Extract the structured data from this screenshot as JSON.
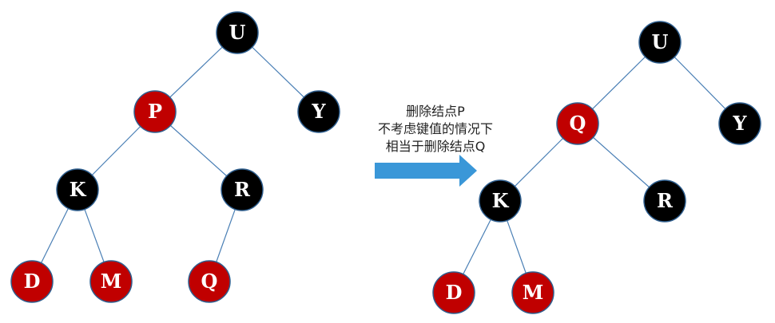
{
  "colors": {
    "black_node": "#000000",
    "red_node": "#c00000",
    "edge": "#4a7fb5",
    "arrow": "#3a97d8"
  },
  "caption": {
    "line1": "删除结点P",
    "line2": "不考虑键值的情况下",
    "line3": "相当于删除结点Q"
  },
  "trees": [
    {
      "id": "before",
      "nodes": [
        {
          "key": "U",
          "color": "black"
        },
        {
          "key": "P",
          "color": "red"
        },
        {
          "key": "Y",
          "color": "black"
        },
        {
          "key": "K",
          "color": "black"
        },
        {
          "key": "R",
          "color": "black"
        },
        {
          "key": "D",
          "color": "red"
        },
        {
          "key": "M",
          "color": "red"
        },
        {
          "key": "Q",
          "color": "red"
        }
      ],
      "edges": [
        [
          "U",
          "P"
        ],
        [
          "U",
          "Y"
        ],
        [
          "P",
          "K"
        ],
        [
          "P",
          "R"
        ],
        [
          "K",
          "D"
        ],
        [
          "K",
          "M"
        ],
        [
          "R",
          "Q"
        ]
      ]
    },
    {
      "id": "after",
      "nodes": [
        {
          "key": "U",
          "color": "black"
        },
        {
          "key": "Q",
          "color": "red"
        },
        {
          "key": "Y",
          "color": "black"
        },
        {
          "key": "K",
          "color": "black"
        },
        {
          "key": "R",
          "color": "black"
        },
        {
          "key": "D",
          "color": "red"
        },
        {
          "key": "M",
          "color": "red"
        }
      ],
      "edges": [
        [
          "U",
          "Q"
        ],
        [
          "U",
          "Y"
        ],
        [
          "Q",
          "K"
        ],
        [
          "Q",
          "R"
        ],
        [
          "K",
          "D"
        ],
        [
          "K",
          "M"
        ]
      ]
    }
  ]
}
